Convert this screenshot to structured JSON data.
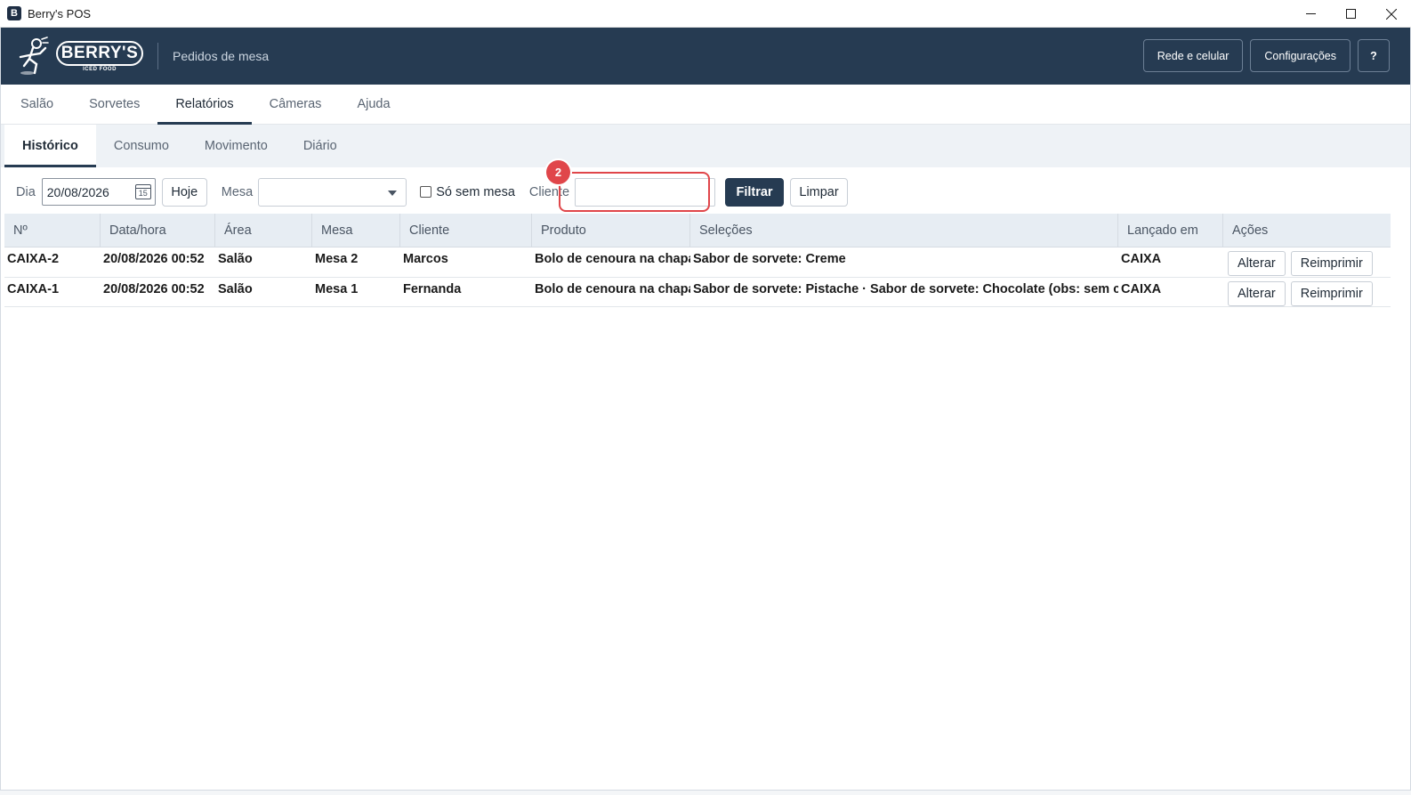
{
  "window": {
    "title": "Berry's POS",
    "app_icon": "B"
  },
  "header": {
    "logo_text": "BERRY'S",
    "logo_subtext": "ICED FOOD",
    "subtitle": "Pedidos de mesa",
    "network_button": "Rede e celular",
    "settings_button": "Configurações",
    "help_button": "?"
  },
  "main_tabs": [
    {
      "label": "Salão"
    },
    {
      "label": "Sorvetes"
    },
    {
      "label": "Relatórios"
    },
    {
      "label": "Câmeras"
    },
    {
      "label": "Ajuda"
    }
  ],
  "sub_tabs": [
    {
      "label": "Histórico"
    },
    {
      "label": "Consumo"
    },
    {
      "label": "Movimento"
    },
    {
      "label": "Diário"
    }
  ],
  "filters": {
    "day_label": "Dia",
    "day_value": "20/08/2026",
    "calendar_day": "15",
    "today_button": "Hoje",
    "table_label": "Mesa",
    "table_value": "",
    "no_table_label": "Só sem mesa",
    "no_table_checked": false,
    "client_label": "Cliente",
    "client_value": "",
    "filter_button": "Filtrar",
    "clear_button": "Limpar",
    "annotation_badge": "2"
  },
  "table": {
    "columns": [
      "Nº",
      "Data/hora",
      "Área",
      "Mesa",
      "Cliente",
      "Produto",
      "Seleções",
      "Lançado em",
      "Ações"
    ],
    "rows": [
      {
        "numero": "CAIXA-2",
        "data_hora": "20/08/2026 00:52",
        "area": "Salão",
        "mesa": "Mesa 2",
        "cliente": "Marcos",
        "produto": "Bolo de cenoura na chapa",
        "selecoes": "Sabor de sorvete: Creme",
        "lancado_em": "CAIXA",
        "alterar": "Alterar",
        "reimprimir": "Reimprimir"
      },
      {
        "numero": "CAIXA-1",
        "data_hora": "20/08/2026 00:52",
        "area": "Salão",
        "mesa": "Mesa 1",
        "cliente": "Fernanda",
        "produto": "Bolo de cenoura na chapa, Bolo de cenoura na chapa",
        "selecoes": "Sabor de sorvete: Pistache · Sabor de sorvete: Chocolate (obs: sem calda)",
        "lancado_em": "CAIXA",
        "alterar": "Alterar",
        "reimprimir": "Reimprimir"
      }
    ]
  },
  "colors": {
    "header_bg": "#263b52",
    "accent": "#263b52",
    "highlight": "#e0464a",
    "subtab_bg": "#eef2f6",
    "table_header_bg": "#e7edf3"
  }
}
